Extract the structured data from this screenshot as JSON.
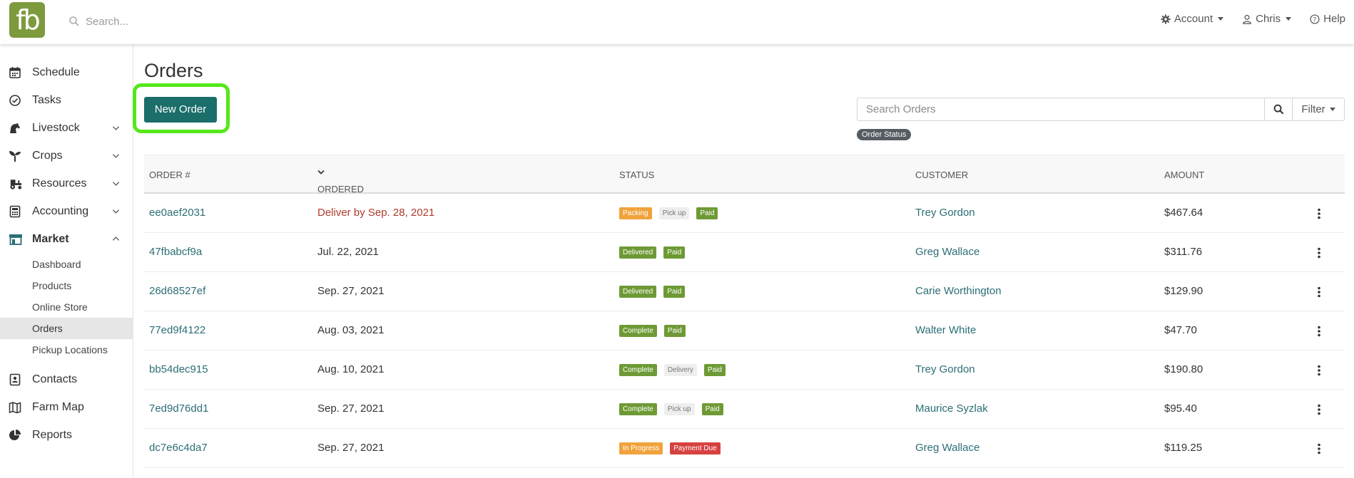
{
  "header": {
    "logo": "fb",
    "search_placeholder": "Search...",
    "nav": [
      {
        "label": "Account",
        "icon": "gear-icon"
      },
      {
        "label": "Chris",
        "icon": "user-icon"
      },
      {
        "label": "Help",
        "icon": "help-icon"
      }
    ]
  },
  "sidebar": {
    "items": [
      {
        "label": "Schedule",
        "icon": "calendar-icon"
      },
      {
        "label": "Tasks",
        "icon": "check-circle-icon"
      },
      {
        "label": "Livestock",
        "icon": "horse-icon",
        "expandable": true
      },
      {
        "label": "Crops",
        "icon": "seedling-icon",
        "expandable": true
      },
      {
        "label": "Resources",
        "icon": "tractor-icon",
        "expandable": true
      },
      {
        "label": "Accounting",
        "icon": "calculator-icon",
        "expandable": true
      },
      {
        "label": "Market",
        "icon": "store-icon",
        "expandable": true,
        "expanded": true
      }
    ],
    "market_sub": [
      "Dashboard",
      "Products",
      "Online Store",
      "Orders",
      "Pickup Locations"
    ],
    "active_sub": "Orders",
    "bottom_items": [
      {
        "label": "Contacts",
        "icon": "address-book-icon"
      },
      {
        "label": "Farm Map",
        "icon": "map-icon"
      },
      {
        "label": "Reports",
        "icon": "pie-chart-icon"
      }
    ]
  },
  "main": {
    "title": "Orders",
    "new_order_label": "New Order",
    "search_placeholder": "Search Orders",
    "filter_label": "Filter",
    "status_chip": "Order Status",
    "columns": {
      "order": "Order #",
      "ordered": "Ordered",
      "status": "Status",
      "customer": "Customer",
      "amount": "Amount"
    },
    "rows": [
      {
        "id": "ee0aef2031",
        "date": "Deliver by Sep. 28, 2021",
        "warn": true,
        "badges": [
          {
            "t": "Packing",
            "c": "orange"
          },
          {
            "t": "Pick up",
            "c": "light"
          },
          {
            "t": "Paid",
            "c": "green"
          }
        ],
        "customer": "Trey Gordon",
        "amount": "$467.64"
      },
      {
        "id": "47fbabcf9a",
        "date": "Jul. 22, 2021",
        "warn": false,
        "badges": [
          {
            "t": "Delivered",
            "c": "green"
          },
          {
            "t": "Paid",
            "c": "green"
          }
        ],
        "customer": "Greg Wallace",
        "amount": "$311.76"
      },
      {
        "id": "26d68527ef",
        "date": "Sep. 27, 2021",
        "warn": false,
        "badges": [
          {
            "t": "Delivered",
            "c": "green"
          },
          {
            "t": "Paid",
            "c": "green"
          }
        ],
        "customer": "Carie Worthington",
        "amount": "$129.90"
      },
      {
        "id": "77ed9f4122",
        "date": "Aug. 03, 2021",
        "warn": false,
        "badges": [
          {
            "t": "Complete",
            "c": "green"
          },
          {
            "t": "Paid",
            "c": "green"
          }
        ],
        "customer": "Walter White",
        "amount": "$47.70"
      },
      {
        "id": "bb54dec915",
        "date": "Aug. 10, 2021",
        "warn": false,
        "badges": [
          {
            "t": "Complete",
            "c": "green"
          },
          {
            "t": "Delivery",
            "c": "light"
          },
          {
            "t": "Paid",
            "c": "green"
          }
        ],
        "customer": "Trey Gordon",
        "amount": "$190.80"
      },
      {
        "id": "7ed9d76dd1",
        "date": "Sep. 27, 2021",
        "warn": false,
        "badges": [
          {
            "t": "Complete",
            "c": "green"
          },
          {
            "t": "Pick up",
            "c": "light"
          },
          {
            "t": "Paid",
            "c": "green"
          }
        ],
        "customer": "Maurice Syzlak",
        "amount": "$95.40"
      },
      {
        "id": "dc7e6c4da7",
        "date": "Sep. 27, 2021",
        "warn": false,
        "badges": [
          {
            "t": "In Progress",
            "c": "orange"
          },
          {
            "t": "Payment Due",
            "c": "red"
          }
        ],
        "customer": "Greg Wallace",
        "amount": "$119.25"
      }
    ]
  },
  "colors": {
    "brand_green": "#7d9a3d",
    "primary_teal": "#1b6e6a",
    "link_teal": "#2b6e76",
    "highlight": "#55e81a",
    "warn_red": "#b03a2e"
  }
}
